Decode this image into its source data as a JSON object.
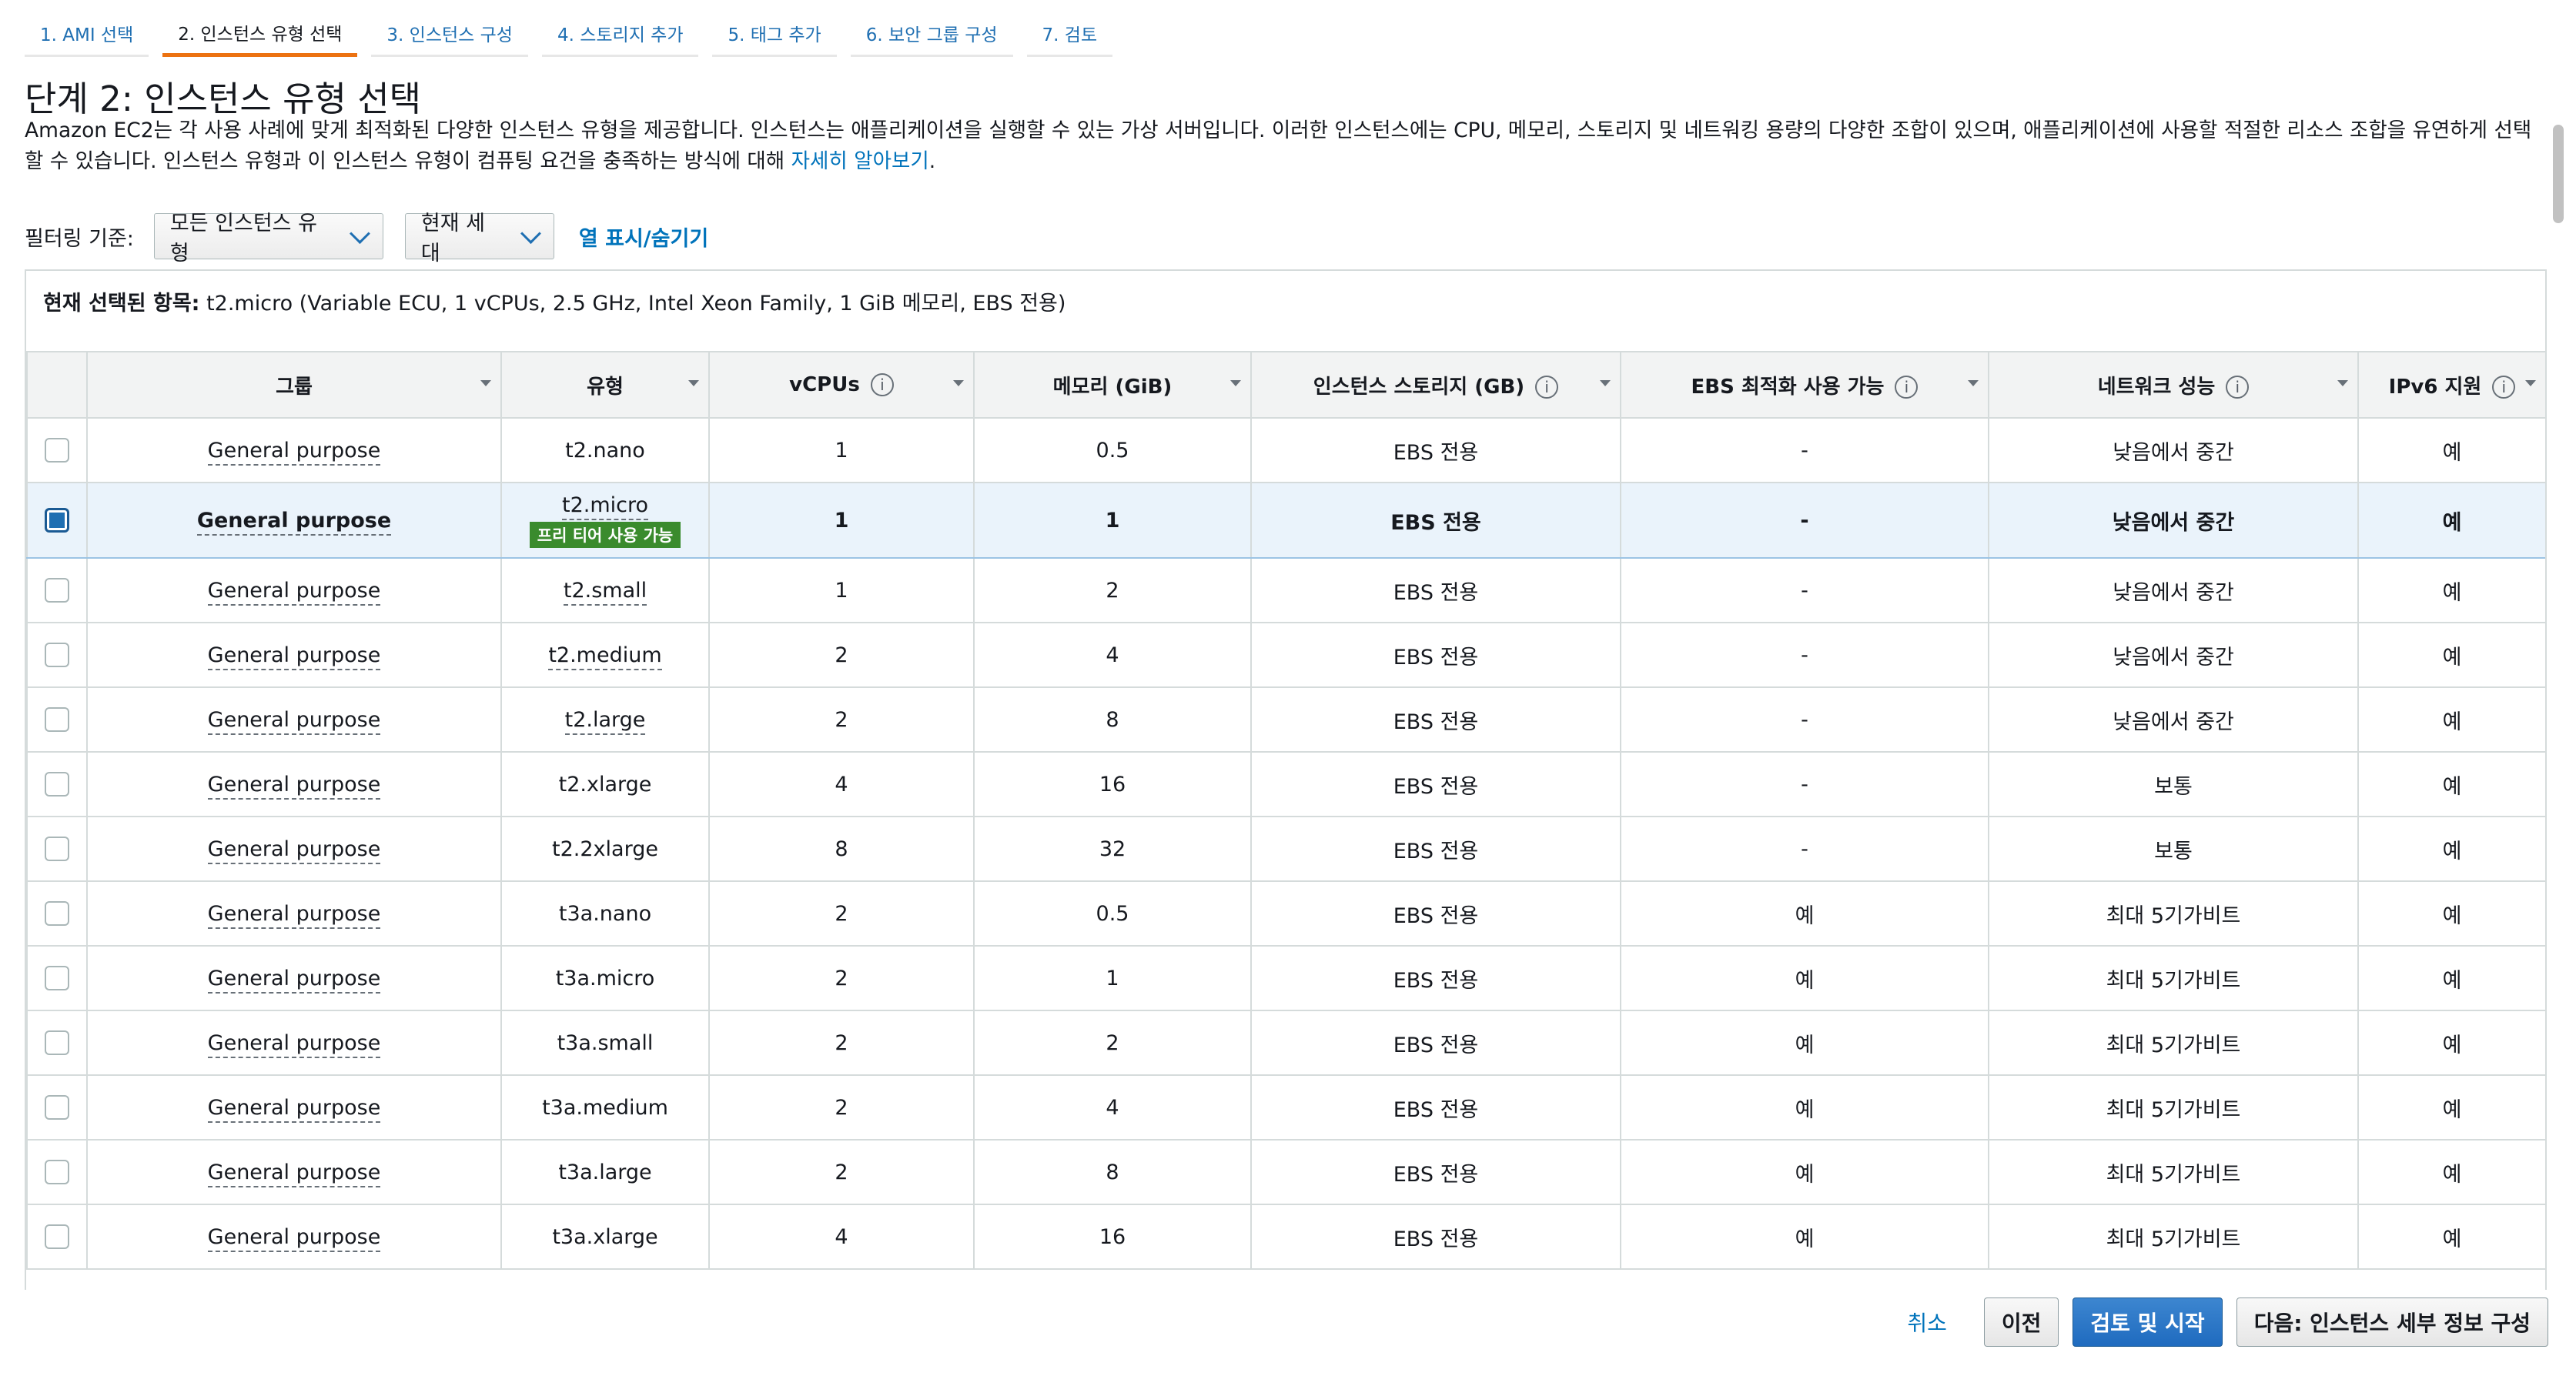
{
  "tabs": [
    {
      "label": "1. AMI 선택",
      "active": false
    },
    {
      "label": "2. 인스턴스 유형 선택",
      "active": true
    },
    {
      "label": "3. 인스턴스 구성",
      "active": false
    },
    {
      "label": "4. 스토리지 추가",
      "active": false
    },
    {
      "label": "5. 태그 추가",
      "active": false
    },
    {
      "label": "6. 보안 그룹 구성",
      "active": false
    },
    {
      "label": "7. 검토",
      "active": false
    }
  ],
  "page": {
    "title": "단계 2: 인스턴스 유형 선택",
    "description": "Amazon EC2는 각 사용 사례에 맞게 최적화된 다양한 인스턴스 유형을 제공합니다. 인스턴스는 애플리케이션을 실행할 수 있는 가상 서버입니다. 이러한 인스턴스에는 CPU, 메모리, 스토리지 및 네트워킹 용량의 다양한 조합이 있으며, 애플리케이션에 사용할 적절한 리소스 조합을 유연하게 선택할 수 있습니다. 인스턴스 유형과 이 인스턴스 유형이 컴퓨팅 요건을 충족하는 방식에 대해 ",
    "learn_more": "자세히 알아보기",
    "desc_end": "."
  },
  "filter": {
    "label": "필터링 기준:",
    "type_select": "모든 인스턴스 유형",
    "generation_select": "현재 세대",
    "column_toggle": "열 표시/숨기기"
  },
  "selection": {
    "label": "현재 선택된 항목:",
    "value": "t2.micro (Variable ECU, 1 vCPUs, 2.5 GHz, Intel Xeon Family, 1 GiB 메모리, EBS 전용)"
  },
  "table": {
    "headers": [
      "그룹",
      "유형",
      "vCPUs",
      "메모리 (GiB)",
      "인스턴스 스토리지 (GB)",
      "EBS 최적화 사용 가능",
      "네트워크 성능",
      "IPv6 지원"
    ],
    "info_icon": "i",
    "free_tier_badge": "프리 티어 사용 가능",
    "rows": [
      {
        "group": "General purpose",
        "type": "t2.nano",
        "vcpus": "1",
        "memory": "0.5",
        "storage": "EBS 전용",
        "ebs": "-",
        "network": "낮음에서 중간",
        "ipv6": "예"
      },
      {
        "group": "General purpose",
        "type": "t2.micro",
        "vcpus": "1",
        "memory": "1",
        "storage": "EBS 전용",
        "ebs": "-",
        "network": "낮음에서 중간",
        "ipv6": "예"
      },
      {
        "group": "General purpose",
        "type": "t2.small",
        "vcpus": "1",
        "memory": "2",
        "storage": "EBS 전용",
        "ebs": "-",
        "network": "낮음에서 중간",
        "ipv6": "예"
      },
      {
        "group": "General purpose",
        "type": "t2.medium",
        "vcpus": "2",
        "memory": "4",
        "storage": "EBS 전용",
        "ebs": "-",
        "network": "낮음에서 중간",
        "ipv6": "예"
      },
      {
        "group": "General purpose",
        "type": "t2.large",
        "vcpus": "2",
        "memory": "8",
        "storage": "EBS 전용",
        "ebs": "-",
        "network": "낮음에서 중간",
        "ipv6": "예"
      },
      {
        "group": "General purpose",
        "type": "t2.xlarge",
        "vcpus": "4",
        "memory": "16",
        "storage": "EBS 전용",
        "ebs": "-",
        "network": "보통",
        "ipv6": "예"
      },
      {
        "group": "General purpose",
        "type": "t2.2xlarge",
        "vcpus": "8",
        "memory": "32",
        "storage": "EBS 전용",
        "ebs": "-",
        "network": "보통",
        "ipv6": "예"
      },
      {
        "group": "General purpose",
        "type": "t3a.nano",
        "vcpus": "2",
        "memory": "0.5",
        "storage": "EBS 전용",
        "ebs": "예",
        "network": "최대 5기가비트",
        "ipv6": "예"
      },
      {
        "group": "General purpose",
        "type": "t3a.micro",
        "vcpus": "2",
        "memory": "1",
        "storage": "EBS 전용",
        "ebs": "예",
        "network": "최대 5기가비트",
        "ipv6": "예"
      },
      {
        "group": "General purpose",
        "type": "t3a.small",
        "vcpus": "2",
        "memory": "2",
        "storage": "EBS 전용",
        "ebs": "예",
        "network": "최대 5기가비트",
        "ipv6": "예"
      },
      {
        "group": "General purpose",
        "type": "t3a.medium",
        "vcpus": "2",
        "memory": "4",
        "storage": "EBS 전용",
        "ebs": "예",
        "network": "최대 5기가비트",
        "ipv6": "예"
      },
      {
        "group": "General purpose",
        "type": "t3a.large",
        "vcpus": "2",
        "memory": "8",
        "storage": "EBS 전용",
        "ebs": "예",
        "network": "최대 5기가비트",
        "ipv6": "예"
      },
      {
        "group": "General purpose",
        "type": "t3a.xlarge",
        "vcpus": "4",
        "memory": "16",
        "storage": "EBS 전용",
        "ebs": "예",
        "network": "최대 5기가비트",
        "ipv6": "예"
      }
    ]
  },
  "footer": {
    "cancel": "취소",
    "previous": "이전",
    "review_launch": "검토 및 시작",
    "next": "다음: 인스턴스 세부 정보 구성"
  },
  "colors": {
    "accent": "#0073bb",
    "active_tab_underline": "#ec7211",
    "primary_button": "#1f6bbf",
    "free_tier_badge": "#3a8b2d",
    "selected_row": "#eaf3fb"
  }
}
